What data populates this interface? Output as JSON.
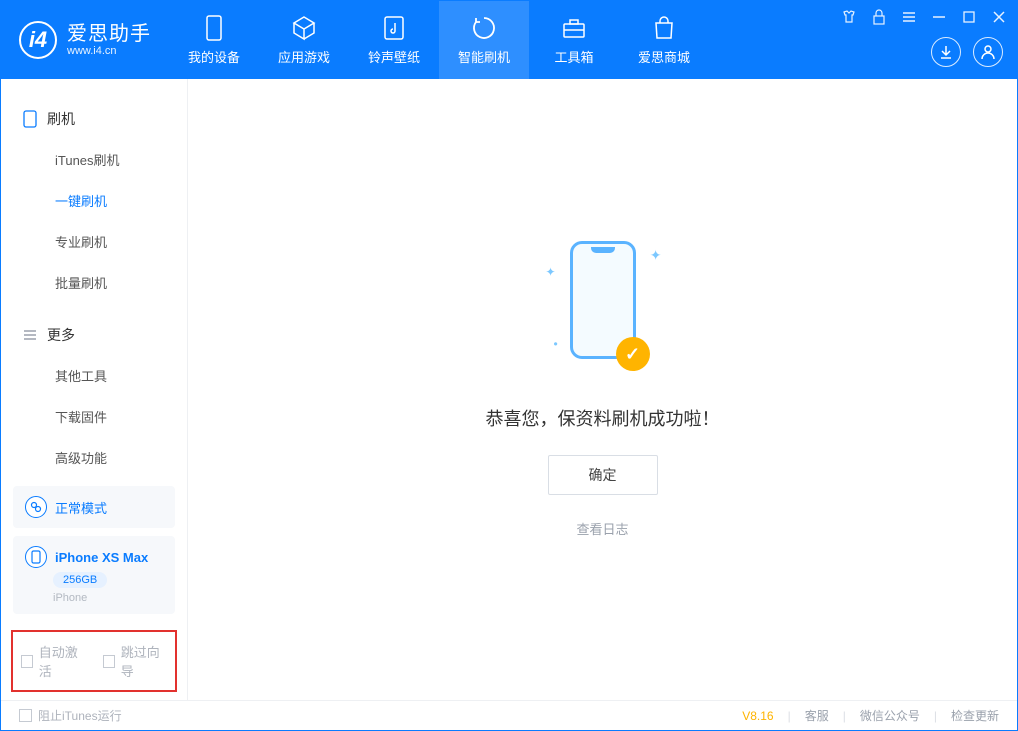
{
  "app": {
    "title": "爱思助手",
    "subtitle": "www.i4.cn"
  },
  "nav": {
    "tabs": [
      {
        "label": "我的设备"
      },
      {
        "label": "应用游戏"
      },
      {
        "label": "铃声壁纸"
      },
      {
        "label": "智能刷机"
      },
      {
        "label": "工具箱"
      },
      {
        "label": "爱思商城"
      }
    ]
  },
  "sidebar": {
    "section1": {
      "title": "刷机",
      "items": [
        "iTunes刷机",
        "一键刷机",
        "专业刷机",
        "批量刷机"
      ]
    },
    "section2": {
      "title": "更多",
      "items": [
        "其他工具",
        "下载固件",
        "高级功能"
      ]
    }
  },
  "device": {
    "mode": "正常模式",
    "name": "iPhone XS Max",
    "capacity": "256GB",
    "type": "iPhone"
  },
  "options": {
    "auto_activate": "自动激活",
    "skip_guide": "跳过向导"
  },
  "main": {
    "success": "恭喜您，保资料刷机成功啦！",
    "ok": "确定",
    "view_log": "查看日志"
  },
  "status": {
    "block_itunes": "阻止iTunes运行",
    "version": "V8.16",
    "links": [
      "客服",
      "微信公众号",
      "检查更新"
    ]
  }
}
